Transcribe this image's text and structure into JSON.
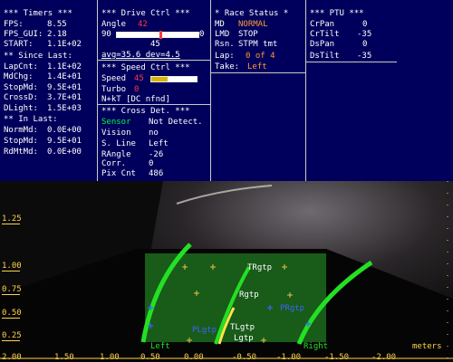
{
  "timers": {
    "title": "*** Timers ***",
    "fps_label": "FPS:",
    "fps_value": "8.55",
    "fps_gui_label": "FPS_GUI:",
    "fps_gui_value": "2.18",
    "start_label": "START:",
    "start_value": "1.1E+02",
    "since_last_title": "** Since Last:",
    "lapcnt_label": "LapCnt:",
    "lapcnt_value": "1.1E+02",
    "mdchg_label": "MdChg:",
    "mdchg_value": "1.4E+01",
    "stopmd_label": "StopMd:",
    "stopmd_value": "9.5E+01",
    "crossd_label": "CrossD:",
    "crossd_value": "3.7E+01",
    "dlight_label": "DLight:",
    "dlight_value": "1.5E+03",
    "in_last_title": "** In Last:",
    "normmd_label": "NormMd:",
    "normmd_value": "0.0E+00",
    "stopmd2_label": "StopMd:",
    "stopmd2_value": "9.5E+01",
    "rdmtmd_label": "RdMtMd:",
    "rdmtmd_value": "0.0E+00"
  },
  "drive": {
    "title": "*** Drive Ctrl ***",
    "angle_label": "Angle",
    "angle_value": "42",
    "slider_min": "90",
    "slider_max": "0",
    "slider_mid": "45",
    "slider_fraction": 0.53,
    "avg_dev": "avg=35.6 dev=4.5",
    "speed_title": "*** Speed Ctrl ***",
    "speed_label": "Speed",
    "speed_value": "45",
    "speed_fraction": 0.35,
    "turbo_label": "Turbo",
    "turbo_value": "0",
    "nkt": "N+kT [DC nfnd]",
    "cross_title": "*** Cross Det. ***",
    "sensor_label": "Sensor",
    "sensor_value": "Not Detect.",
    "vision_label": "Vision",
    "vision_value": "no",
    "sline_label": "S. Line",
    "sline_value": "Left",
    "rangle_label": "RAngle",
    "rangle_value": "-26",
    "corr_label": "Corr.",
    "corr_value": "0",
    "pix_label": "Pix Cnt",
    "pix_value": "486"
  },
  "race": {
    "title": "* Race Status *",
    "md_label": "MD",
    "md_value": "NORMAL",
    "lmd_label": "LMD",
    "lmd_value": "STOP",
    "rsn_label": "Rsn.",
    "rsn_value": "STPM tmt",
    "lap_label": "Lap:",
    "lap_value": "0 of 4",
    "take_label": "Take:",
    "take_value": "Left"
  },
  "ptu": {
    "title": "*** PTU ***",
    "crpan_label": "CrPan",
    "crpan_value": "0",
    "crtilt_label": "CrTilt",
    "crtilt_value": "-35",
    "dspan_label": "DsPan",
    "dspan_value": "0",
    "dstilt_label": "DsTilt",
    "dstilt_value": "-35"
  },
  "camera": {
    "y_ticks": [
      "1.25",
      "1.00",
      "0.75",
      "0.50",
      "0.25"
    ],
    "x_ticks": [
      "2.00",
      "1.50",
      "1.00",
      "0.50",
      "0.00",
      "-0.50",
      "-1.00",
      "-1.50",
      "-2.00"
    ],
    "units_label": "meters",
    "markers": {
      "trgtp": "TRgtp",
      "rgtp": "Rgtp",
      "prgtp": "PRgtp",
      "plgtp": "PLgtp",
      "tlgtp": "TLgtp",
      "lgtp": "Lgtp",
      "left_label": "Left",
      "right_label": "Right"
    }
  },
  "colors": {
    "panel_bg": "#00005c",
    "track_fill": "#1d6b1d",
    "lane_line": "#24e024",
    "accent_red": "#ff3a3a",
    "accent_orange": "#ff9a35",
    "tick_yellow": "#ffd34a"
  }
}
